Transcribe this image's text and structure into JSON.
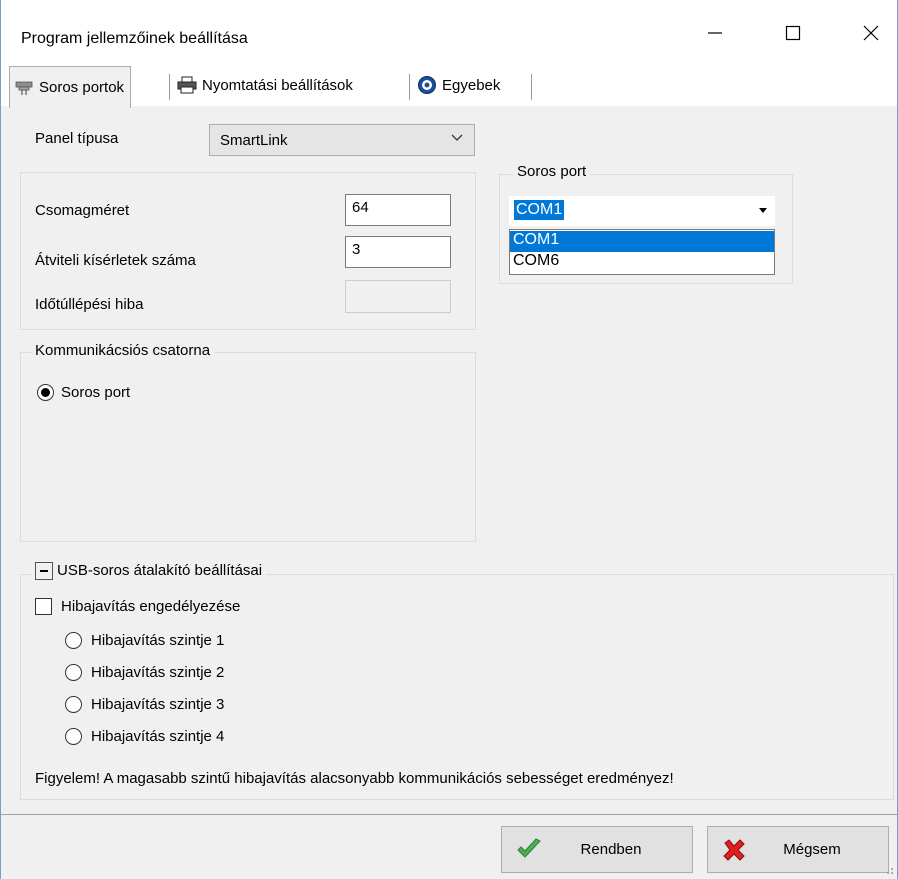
{
  "window": {
    "title": "Program jellemzőinek beállítása",
    "minimize_glyph": "—",
    "maximize_glyph": "☐",
    "close_glyph": "✕"
  },
  "tabs": [
    {
      "label": "Soros portok",
      "icon": "serial-port-icon",
      "active": true
    },
    {
      "label": "Nyomtatási beállítások",
      "icon": "printer-icon",
      "active": false
    },
    {
      "label": "Egyebek",
      "icon": "gear-icon",
      "active": false
    }
  ],
  "panel_type": {
    "label": "Panel típusa",
    "value": "SmartLink"
  },
  "packet_group": {
    "packet_size_label": "Csomagméret",
    "packet_size_value": "64",
    "retry_label": "Átviteli kísérletek száma",
    "retry_value": "3",
    "timeout_label": "Időtúllépési hiba",
    "timeout_value": ""
  },
  "serial_port_group": {
    "title": "Soros port",
    "selected": "COM1",
    "options": [
      "COM1",
      "COM6"
    ],
    "highlighted_option": "COM1"
  },
  "channel_group": {
    "title": "Kommunikácsiós csatorna",
    "option_label": "Soros port",
    "checked": true
  },
  "usb_group": {
    "title": "USB-soros átalakító beállításai",
    "enable_label": "Hibajavítás engedélyezése",
    "enable_checked": false,
    "levels": [
      "Hibajavítás szintje 1",
      "Hibajavítás szintje 2",
      "Hibajavítás szintje 3",
      "Hibajavítás szintje 4"
    ],
    "warning": "Figyelem! A magasabb szintű hibajavítás alacsonyabb kommunikációs sebességet eredményez!"
  },
  "buttons": {
    "ok_label": "Rendben",
    "cancel_label": "Mégsem"
  },
  "colors": {
    "accent": "#0078d7",
    "ok_icon": "#2e9a2e",
    "cancel_icon": "#d01010"
  }
}
